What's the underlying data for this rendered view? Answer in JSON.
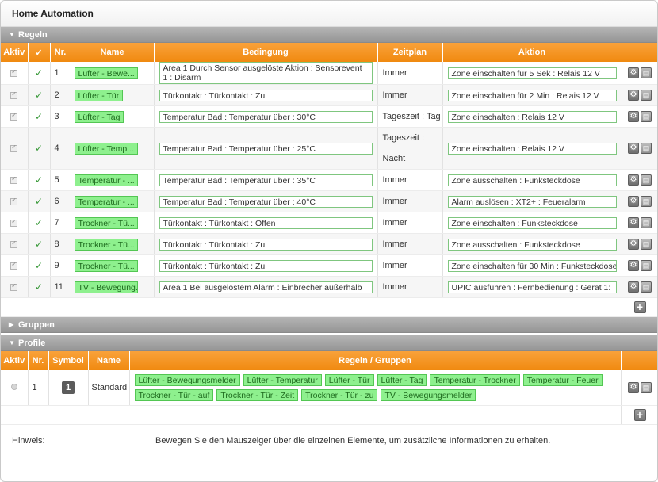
{
  "app": {
    "title": "Home Automation"
  },
  "sections": {
    "regeln": "Regeln",
    "gruppen": "Gruppen",
    "profile": "Profile"
  },
  "rules_table": {
    "headers": [
      "Aktiv",
      "✓",
      "Nr.",
      "Name",
      "Bedingung",
      "Zeitplan",
      "Aktion"
    ],
    "rows": [
      {
        "nr": "1",
        "name": "Lüfter - Bewe...",
        "bedingung": "Area 1 Durch Sensor ausgelöste Aktion : Sensorevent 1 : Disarm",
        "zeitplan": "Immer",
        "aktion": "Zone einschalten für 5 Sek : Relais 12 V"
      },
      {
        "nr": "2",
        "name": "Lüfter - Tür",
        "bedingung": "Türkontakt : Türkontakt : Zu",
        "zeitplan": "Immer",
        "aktion": "Zone einschalten für 2 Min : Relais 12 V"
      },
      {
        "nr": "3",
        "name": "Lüfter - Tag",
        "bedingung": "Temperatur Bad : Temperatur über : 30°C",
        "zeitplan": "Tageszeit : Tag",
        "aktion": "Zone einschalten : Relais 12 V"
      },
      {
        "nr": "4",
        "name": "Lüfter - Temp...",
        "bedingung": "Temperatur Bad : Temperatur über : 25°C",
        "zeitplan": "Tageszeit : Nacht",
        "aktion": "Zone einschalten : Relais 12 V"
      },
      {
        "nr": "5",
        "name": "Temperatur - ...",
        "bedingung": "Temperatur Bad : Temperatur über : 35°C",
        "zeitplan": "Immer",
        "aktion": "Zone ausschalten : Funksteckdose"
      },
      {
        "nr": "6",
        "name": "Temperatur - ...",
        "bedingung": "Temperatur Bad : Temperatur über : 40°C",
        "zeitplan": "Immer",
        "aktion": "Alarm auslösen : XT2+ : Feueralarm"
      },
      {
        "nr": "7",
        "name": "Trockner - Tü...",
        "bedingung": "Türkontakt : Türkontakt : Offen",
        "zeitplan": "Immer",
        "aktion": "Zone einschalten : Funksteckdose"
      },
      {
        "nr": "8",
        "name": "Trockner - Tü...",
        "bedingung": "Türkontakt : Türkontakt : Zu",
        "zeitplan": "Immer",
        "aktion": "Zone ausschalten : Funksteckdose"
      },
      {
        "nr": "9",
        "name": "Trockner - Tü...",
        "bedingung": "Türkontakt : Türkontakt : Zu",
        "zeitplan": "Immer",
        "aktion": "Zone einschalten für 30 Min : Funksteckdose"
      },
      {
        "nr": "11",
        "name": "TV - Bewegung...",
        "bedingung": "Area 1 Bei ausgelöstem Alarm : Einbrecher außerhalb",
        "zeitplan": "Immer",
        "aktion": "UPIC ausführen : Fernbedienung : Gerät 1:"
      }
    ]
  },
  "profile_table": {
    "headers": [
      "Aktiv",
      "Nr.",
      "Symbol",
      "Name",
      "Regeln / Gruppen"
    ],
    "rows": [
      {
        "nr": "1",
        "symbol": "1",
        "name": "Standard",
        "tags": [
          "Lüfter - Bewegungsmelder",
          "Lüfter - Temperatur",
          "Lüfter - Tür",
          "Lüfter - Tag",
          "Temperatur - Trockner",
          "Temperatur - Feuer",
          "Trockner - Tür - auf",
          "Trockner - Tür - Zeit",
          "Trockner - Tür - zu",
          "TV - Bewegungsmelder"
        ]
      }
    ]
  },
  "hint": {
    "label": "Hinweis:",
    "text": "Bewegen Sie den Mauszeiger über die einzelnen Elemente, um zusätzliche Informationen zu erhalten."
  },
  "icons": {
    "edit": "gear-icon",
    "delete": "trash-icon",
    "add": "plus-icon",
    "expanded": "triangle-down-icon",
    "collapsed": "triangle-right-icon"
  },
  "colors": {
    "header_orange": "#f08a10",
    "tag_green": "#8ef08e",
    "section_gray": "#a5a5a5"
  }
}
